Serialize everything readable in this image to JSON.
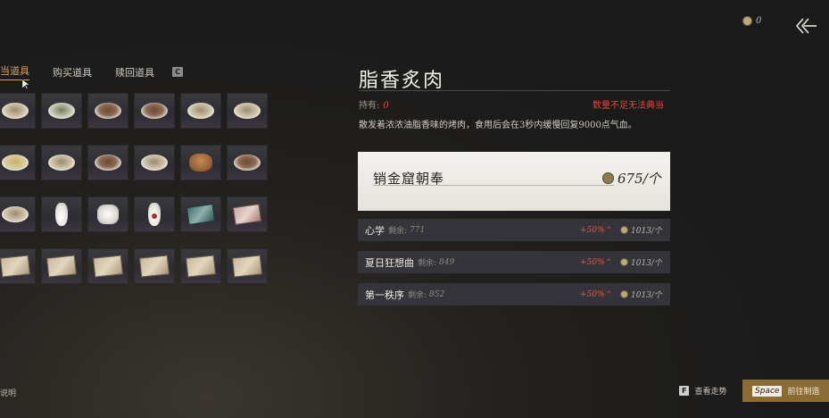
{
  "header": {
    "currency_amount": "0"
  },
  "tabs": [
    {
      "label": "当道具",
      "active": true
    },
    {
      "label": "购买道具",
      "active": false
    },
    {
      "label": "赎回道具",
      "active": false
    }
  ],
  "tab_hotkey": "C",
  "grid_rows": [
    [
      "bowl",
      "bowl-green",
      "bowl-meat",
      "bowl-meat",
      "bowl",
      "bowl"
    ],
    [
      "bowl-soup",
      "bowl",
      "bowl-meat",
      "bowl",
      "bun",
      "bowl-meat"
    ],
    [
      "bowl",
      "vase",
      "jar",
      "vase-red",
      "box",
      "box-pink"
    ],
    [
      "paper",
      "paper",
      "paper",
      "paper",
      "paper",
      "paper"
    ]
  ],
  "item": {
    "name": "脂香炙肉",
    "own_label": "持有:",
    "own_count": "0",
    "warning": "数量不足无法典当",
    "description": "散发着浓浓油脂香味的烤肉，食用后会在3秒内缓慢回复9000点气血。"
  },
  "selected_offer": {
    "name": "销金窟朝奉",
    "price": "675/个"
  },
  "offers": [
    {
      "name": "心学",
      "remaining_label": "剩余:",
      "remaining": "771",
      "bonus": "+50%",
      "price": "1013/个"
    },
    {
      "name": "夏日狂想曲",
      "remaining_label": "剩余:",
      "remaining": "849",
      "bonus": "+50%",
      "price": "1013/个"
    },
    {
      "name": "第一秩序",
      "remaining_label": "剩余:",
      "remaining": "852",
      "bonus": "+50%",
      "price": "1013/个"
    }
  ],
  "footer": {
    "left_text": "说明",
    "trend_key": "F",
    "trend_label": "查看走势",
    "craft_key": "Space",
    "craft_label": "前往制造"
  }
}
